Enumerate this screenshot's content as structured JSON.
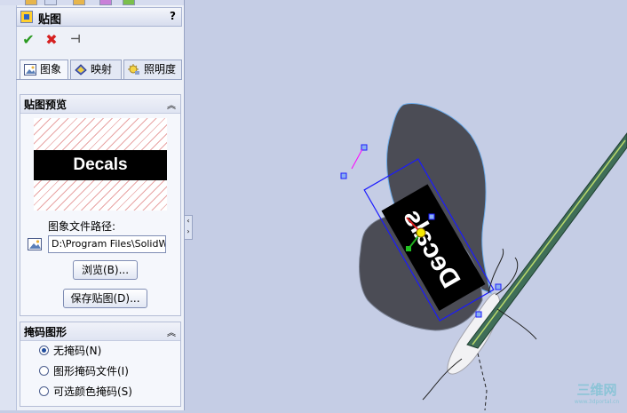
{
  "panel": {
    "title": "贴图",
    "help": "?",
    "actions": {
      "ok": "✔",
      "cancel": "✖",
      "pin": "⊣"
    },
    "tabs": [
      {
        "label": "图象",
        "icon": "image-icon"
      },
      {
        "label": "映射",
        "icon": "mapping-icon"
      },
      {
        "label": "照明度",
        "icon": "lighting-icon"
      }
    ],
    "preview_group": {
      "title": "贴图预览",
      "preview_text": "Decals",
      "path_label": "图象文件路径:",
      "path_value": "D:\\Program Files\\SolidWorks",
      "browse_label": "浏览(B)...",
      "save_label": "保存贴图(D)..."
    },
    "mask_group": {
      "title": "掩码图形",
      "options": [
        {
          "label": "无掩码(N)",
          "selected": true
        },
        {
          "label": "图形掩码文件(I)",
          "selected": false
        },
        {
          "label": "可选颜色掩码(S)",
          "selected": false
        }
      ]
    }
  },
  "viewport": {
    "decal_text": "Decals"
  },
  "watermark": {
    "main": "三维网",
    "sub": "www.3dportal.cn"
  },
  "colors": {
    "background": "#c5cde5",
    "panel": "#eef1f8",
    "wing": "#4b4c55",
    "decal_outline": "#1a1aff",
    "ok": "#2a9a20",
    "cancel": "#d62020"
  }
}
